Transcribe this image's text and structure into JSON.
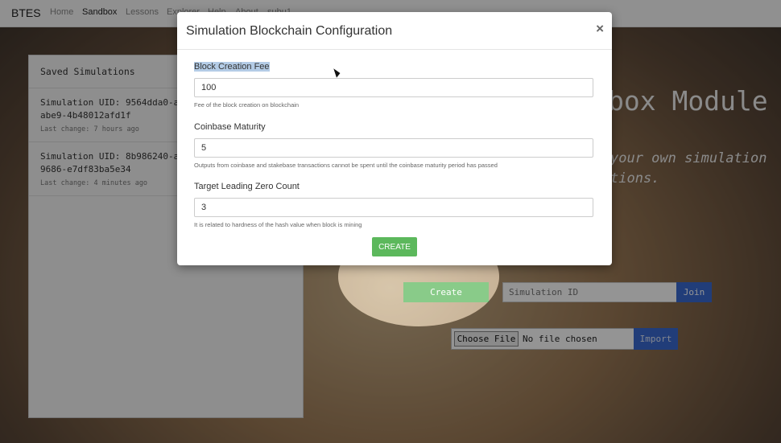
{
  "navbar": {
    "brand": "BTES",
    "links": [
      "Home",
      "Sandbox",
      "Lessons",
      "Explorer",
      "Help",
      "About",
      "subu1"
    ]
  },
  "saved": {
    "title": "Saved Simulations",
    "items": [
      {
        "uid": "Simulation UID: 9564dda0-a…abe9-4b48012afd1f",
        "uid_line1": "Simulation UID: 9564dda0-a",
        "uid_line2": "abe9-4b48012afd1f",
        "changed": "Last change: 7 hours ago"
      },
      {
        "uid": "Simulation UID: 8b986240-a…9686-e7df83ba5e34",
        "uid_line1": "Simulation UID: 8b986240-a",
        "uid_line2": "9686-e7df83ba5e34",
        "changed": "Last change: 4 minutes ago"
      }
    ]
  },
  "hero": {
    "title": "box Module",
    "subtitle": "your own simulation\ntions."
  },
  "actions": {
    "create_label": "Create",
    "sim_id_placeholder": "Simulation ID",
    "join_label": "Join",
    "choose_file_label": "Choose File",
    "no_file_text": "No file chosen",
    "import_label": "Import"
  },
  "modal": {
    "title": "Simulation Blockchain Configuration",
    "close": "×",
    "fields": [
      {
        "label": "Block Creation Fee",
        "value": "100",
        "help": "Fee of the block creation on blockchain"
      },
      {
        "label": "Coinbase Maturity",
        "value": "5",
        "help": "Outputs from coinbase and stakebase transactions cannot be spent until the coinbase maturity period has passed"
      },
      {
        "label": "Target Leading Zero Count",
        "value": "3",
        "help": "It is related to hardness of the hash value when block is mining"
      }
    ],
    "create_label": "CREATE"
  },
  "colors": {
    "success": "#5cb85c",
    "primary": "#3a6ad1",
    "selection": "#b4cce6"
  }
}
